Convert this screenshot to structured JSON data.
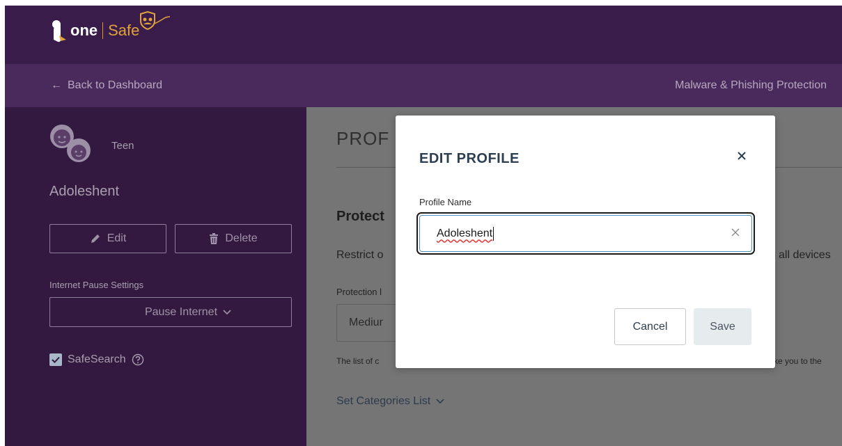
{
  "header": {
    "logo_one": "one",
    "logo_safe": "Safe",
    "back_link": "Back to Dashboard",
    "right_link": "Malware & Phishing Protection"
  },
  "sidebar": {
    "profile_type": "Teen",
    "profile_name": "Adoleshent",
    "edit_label": "Edit",
    "delete_label": "Delete",
    "pause_settings_label": "Internet Pause Settings",
    "pause_select_value": "Pause Internet",
    "safesearch_label": "SafeSearch"
  },
  "main": {
    "title": "PROF",
    "section_title": "Protect",
    "section_desc": "Restrict o",
    "section_desc_right": "all devices",
    "level_label": "Protection l",
    "level_value": "Mediur",
    "list_note": "The list of c",
    "list_note_right": "ke you to the",
    "set_categories": "Set Categories List"
  },
  "modal": {
    "title": "EDIT PROFILE",
    "field_label": "Profile Name",
    "field_value": "Adoleshent",
    "cancel_label": "Cancel",
    "save_label": "Save"
  },
  "colors": {
    "topbar": "#3a1c4b",
    "subbar": "#4a2a5c",
    "sidebar": "#33193f",
    "accent_gold": "#e0a23a",
    "overlay": "#757575"
  }
}
